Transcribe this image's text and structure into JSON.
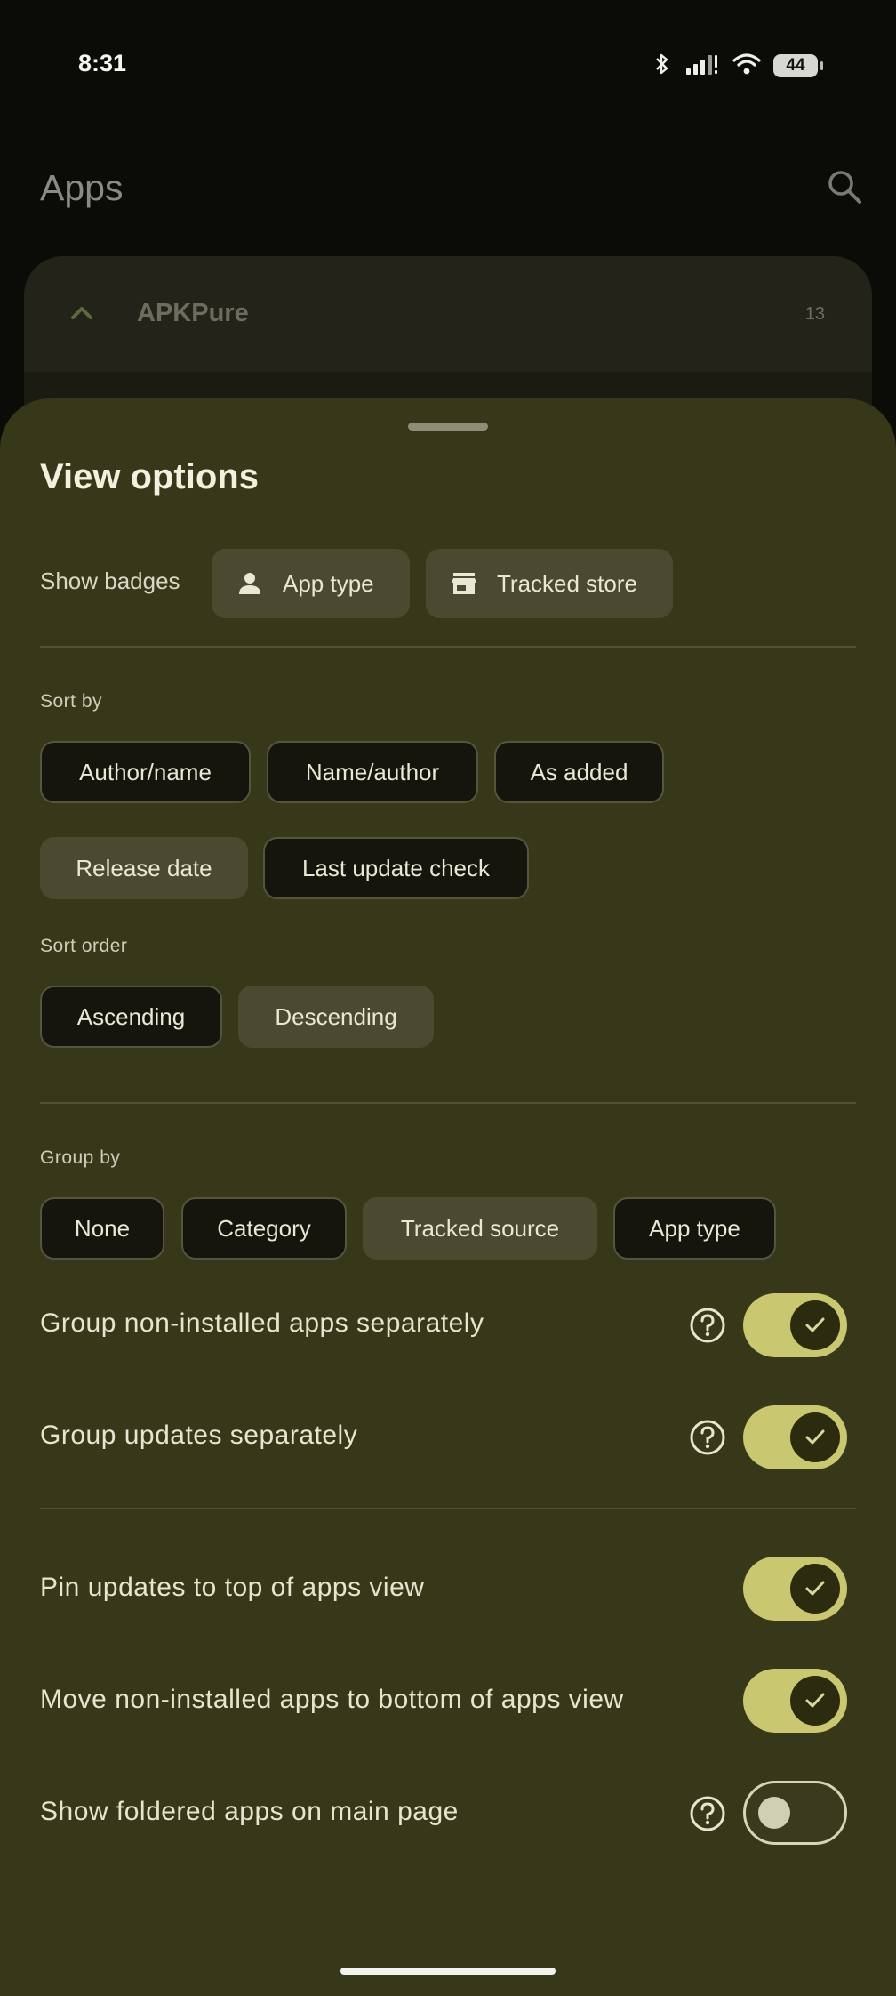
{
  "status_bar": {
    "time": "8:31",
    "battery": "44",
    "icons": [
      "bluetooth-icon",
      "signal-icon",
      "wifi-icon",
      "battery-icon"
    ]
  },
  "app_bar": {
    "title": "Apps",
    "search_icon": "search-icon"
  },
  "group": {
    "name": "APKPure",
    "count": "13"
  },
  "sheet": {
    "title": "View options",
    "badges": {
      "label": "Show badges",
      "chips": [
        {
          "label": "App type",
          "icon": "person-icon"
        },
        {
          "label": "Tracked store",
          "icon": "store-icon"
        }
      ]
    },
    "sort_by": {
      "label": "Sort by",
      "options": [
        "Author/name",
        "Name/author",
        "As added",
        "Release date",
        "Last update check"
      ],
      "selected": "Release date"
    },
    "sort_order": {
      "label": "Sort order",
      "options": [
        "Ascending",
        "Descending"
      ],
      "selected": "Descending"
    },
    "group_by": {
      "label": "Group by",
      "options": [
        "None",
        "Category",
        "Tracked source",
        "App type"
      ],
      "selected": "Tracked source"
    },
    "toggles": [
      {
        "label": "Group non-installed apps separately",
        "on": true,
        "help": true
      },
      {
        "label": "Group updates separately",
        "on": true,
        "help": true
      },
      {
        "label": "Pin updates to top of apps view",
        "on": true,
        "help": false
      },
      {
        "label": "Move non-installed apps to bottom of apps view",
        "on": true,
        "help": false
      },
      {
        "label": "Show foldered apps on main page",
        "on": false,
        "help": true
      }
    ]
  },
  "colors": {
    "sheet_bg": "#373719",
    "accent": "#c9c871",
    "chip_selected": "#4a4a30",
    "chip_outlined": "#15150d"
  }
}
